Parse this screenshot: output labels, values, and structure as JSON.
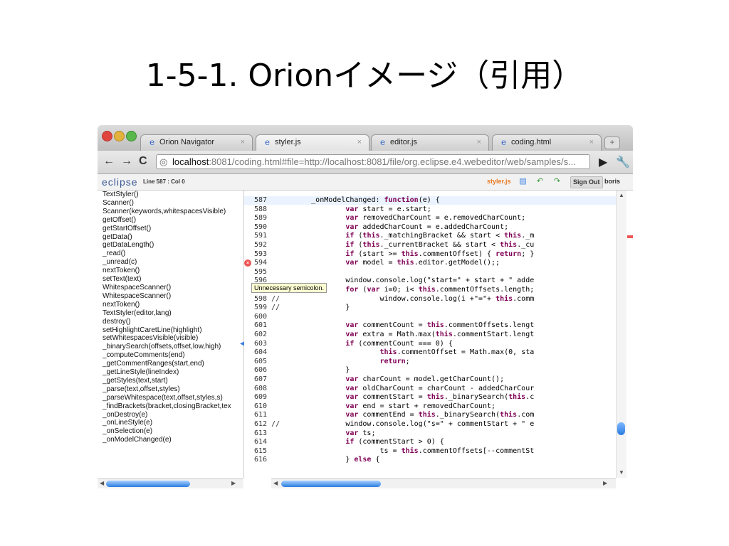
{
  "slide": {
    "title": "1-5-1. Orionイメージ（引用）"
  },
  "browser": {
    "tabs": [
      {
        "label": "Orion Navigator",
        "icon": "ie-icon",
        "active": false
      },
      {
        "label": "styler.js",
        "icon": "ie-icon",
        "active": true
      },
      {
        "label": "editor.js",
        "icon": "ie-icon",
        "active": false
      },
      {
        "label": "coding.html",
        "icon": "ie-icon",
        "active": false
      }
    ],
    "tab_close": "×",
    "new_tab": "+",
    "url_host": "localhost",
    "url_rest": ":8081/coding.html#file=http://localhost:8081/file/org.eclipse.e4.webeditor/web/samples/s...",
    "back": "←",
    "forward": "→",
    "reload": "C"
  },
  "orion": {
    "logo": "eclipse",
    "position": "Line 587 : Col 0",
    "file_name": "styler.js",
    "sign_out": "Sign Out",
    "user": "boris"
  },
  "outline": [
    "TextStyler()",
    "Scanner()",
    "Scanner(keywords,whitespacesVisible)",
    "getOffset()",
    "getStartOffset()",
    "getData()",
    "getDataLength()",
    "_read()",
    "_unread(c)",
    "nextToken()",
    "setText(text)",
    "WhitespaceScanner()",
    "WhitespaceScanner()",
    "nextToken()",
    "TextStyler(editor,lang)",
    "destroy()",
    "setHighlightCaretLine(highlight)",
    "setWhitespacesVisible(visible)",
    "_binarySearch(offsets,offset,low,high)",
    "_computeComments(end)",
    "_getCommentRanges(start,end)",
    "_getLineStyle(lineIndex)",
    "_getStyles(text,start)",
    "_parse(text,offset,styles)",
    "_parseWhitespace(text,offset,styles,s)",
    "_findBrackets(bracket,closingBracket,tex",
    "_onDestroy(e)",
    "_onLineStyle(e)",
    "_onSelection(e)",
    "_onModelChanged(e)"
  ],
  "editor": {
    "tooltip": "Unnecessary semicolon.",
    "lines": [
      {
        "n": "587",
        "code": "        _onModelChanged: function(e) {"
      },
      {
        "n": "588",
        "code": "                var start = e.start;"
      },
      {
        "n": "589",
        "code": "                var removedCharCount = e.removedCharCount;"
      },
      {
        "n": "590",
        "code": "                var addedCharCount = e.addedCharCount;"
      },
      {
        "n": "591",
        "code": "                if (this._matchingBracket && start < this._m"
      },
      {
        "n": "592",
        "code": "                if (this._currentBracket && start < this._cu"
      },
      {
        "n": "593",
        "code": "                if (start >= this.commentOffset) { return; }"
      },
      {
        "n": "594",
        "code": "                var model = this.editor.getModel();;"
      },
      {
        "n": "595",
        "code": ""
      },
      {
        "n": "596",
        "code": "                window.console.log(\"start=\" + start + \" adde"
      },
      {
        "n": "597 //",
        "code": "                for (var i=0; i< this.commentOffsets.length;"
      },
      {
        "n": "598 //",
        "code": "                        window.console.log(i +\"=\"+ this.comm"
      },
      {
        "n": "599 //",
        "code": "                }"
      },
      {
        "n": "600",
        "code": ""
      },
      {
        "n": "601",
        "code": "                var commentCount = this.commentOffsets.lengt"
      },
      {
        "n": "602",
        "code": "                var extra = Math.max(this.commentStart.lengt"
      },
      {
        "n": "603",
        "code": "                if (commentCount === 0) {"
      },
      {
        "n": "604",
        "code": "                        this.commentOffset = Math.max(0, sta"
      },
      {
        "n": "605",
        "code": "                        return;"
      },
      {
        "n": "606",
        "code": "                }"
      },
      {
        "n": "607",
        "code": "                var charCount = model.getCharCount();"
      },
      {
        "n": "608",
        "code": "                var oldCharCount = charCount - addedCharCour"
      },
      {
        "n": "609",
        "code": "                var commentStart = this._binarySearch(this.c"
      },
      {
        "n": "610",
        "code": "                var end = start + removedCharCount;"
      },
      {
        "n": "611",
        "code": "                var commentEnd = this._binarySearch(this.com"
      },
      {
        "n": "612 //",
        "code": "                window.console.log(\"s=\" + commentStart + \" e"
      },
      {
        "n": "613",
        "code": "                var ts;"
      },
      {
        "n": "614",
        "code": "                if (commentStart > 0) {"
      },
      {
        "n": "615",
        "code": "                        ts = this.commentOffsets[--commentSt"
      },
      {
        "n": "616",
        "code": "                } else {"
      }
    ]
  },
  "colors": {
    "keyword": "#7f0055",
    "logo": "#3b5998",
    "file_name": "#e87a23",
    "error": "#e55555"
  }
}
